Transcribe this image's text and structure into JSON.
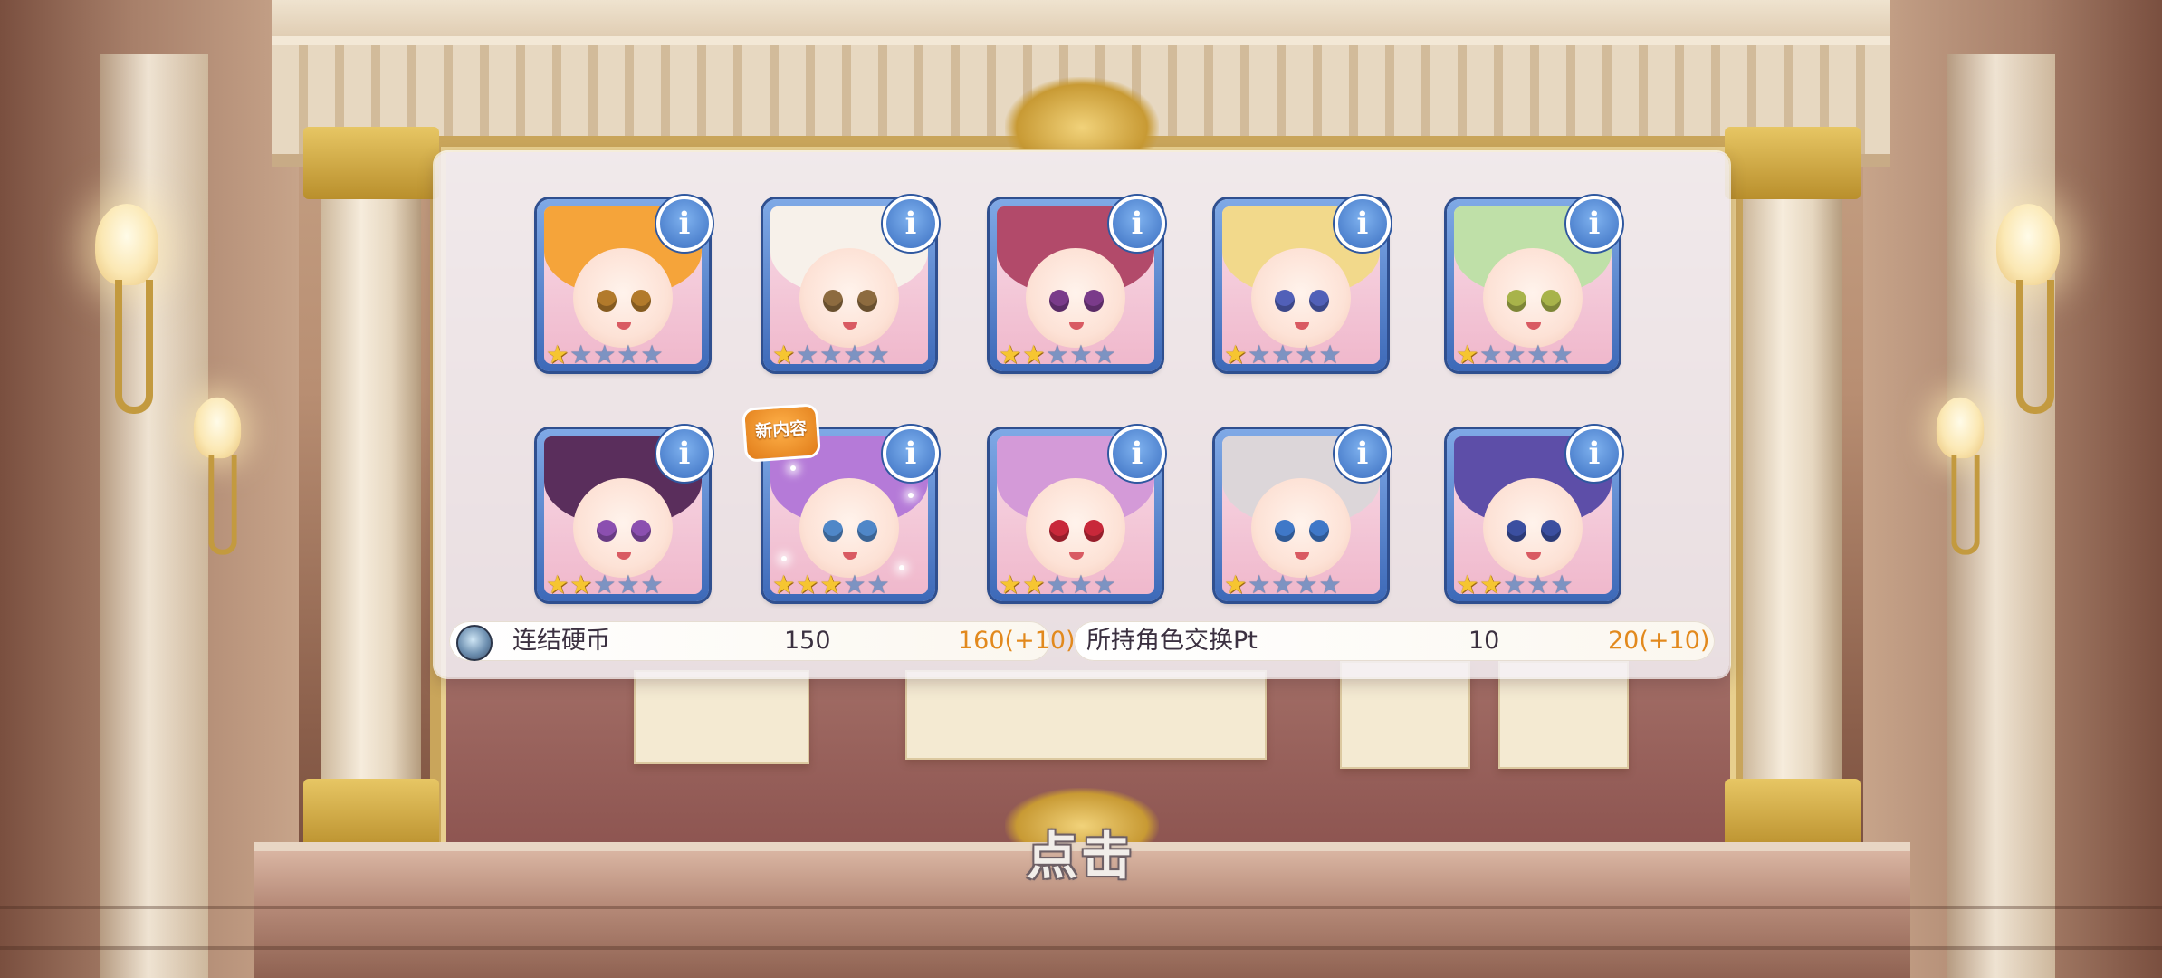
{
  "characters": [
    {
      "stars": 1,
      "max_stars": 5,
      "hair": "#f5a43a",
      "eyes": "#b27a2b",
      "info_icon": "info-icon"
    },
    {
      "stars": 1,
      "max_stars": 5,
      "hair": "#f7f1ea",
      "eyes": "#8d6b3f",
      "info_icon": "info-icon"
    },
    {
      "stars": 2,
      "max_stars": 5,
      "hair": "#b24a6a",
      "eyes": "#7a3b8a",
      "info_icon": "info-icon"
    },
    {
      "stars": 1,
      "max_stars": 5,
      "hair": "#f2d98b",
      "eyes": "#5160b8",
      "info_icon": "info-icon"
    },
    {
      "stars": 1,
      "max_stars": 5,
      "hair": "#bfe0a8",
      "eyes": "#a8b34a",
      "info_icon": "info-icon"
    },
    {
      "stars": 2,
      "max_stars": 5,
      "hair": "#5a2e5c",
      "eyes": "#8b4fb0",
      "info_icon": "info-icon"
    },
    {
      "stars": 3,
      "max_stars": 5,
      "hair": "#b57ad8",
      "eyes": "#4f87c8",
      "info_icon": "info-icon",
      "badge": "新内容"
    },
    {
      "stars": 2,
      "max_stars": 5,
      "hair": "#d49ad8",
      "eyes": "#c8283a",
      "info_icon": "info-icon"
    },
    {
      "stars": 1,
      "max_stars": 5,
      "hair": "#dcd6d9",
      "eyes": "#3f78c8",
      "info_icon": "info-icon"
    },
    {
      "stars": 2,
      "max_stars": 5,
      "hair": "#5d4ea8",
      "eyes": "#3b4fa0",
      "info_icon": "info-icon"
    }
  ],
  "resources": [
    {
      "icon": "connection-coin-icon",
      "label": "连结硬币",
      "current": "150",
      "after": "160(+10)"
    },
    {
      "label": "所持角色交换Pt",
      "current": "10",
      "after": "20(+10)"
    }
  ],
  "tap_prompt": "点击",
  "colors": {
    "accent_orange": "#e2891d",
    "card_blue": "#3d69b8",
    "star_gold": "#f6c531"
  }
}
